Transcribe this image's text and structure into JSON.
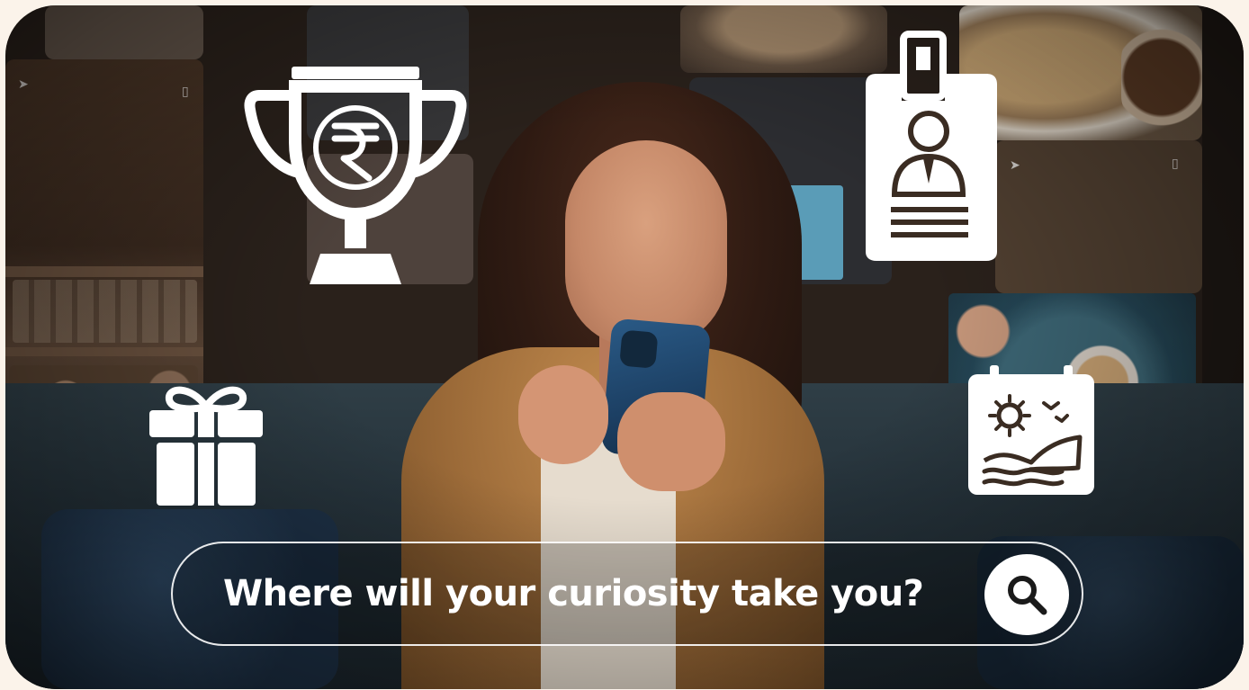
{
  "search": {
    "prompt": "Where will your curiosity take you?"
  },
  "icons": {
    "trophy": "trophy-rupee-icon",
    "id_badge": "id-badge-icon",
    "gift": "gift-icon",
    "calendar": "calendar-beach-icon",
    "search": "search-icon"
  },
  "colors": {
    "page_background": "#fbf3ea",
    "icon_fill": "#ffffff",
    "search_text": "#ffffff"
  }
}
